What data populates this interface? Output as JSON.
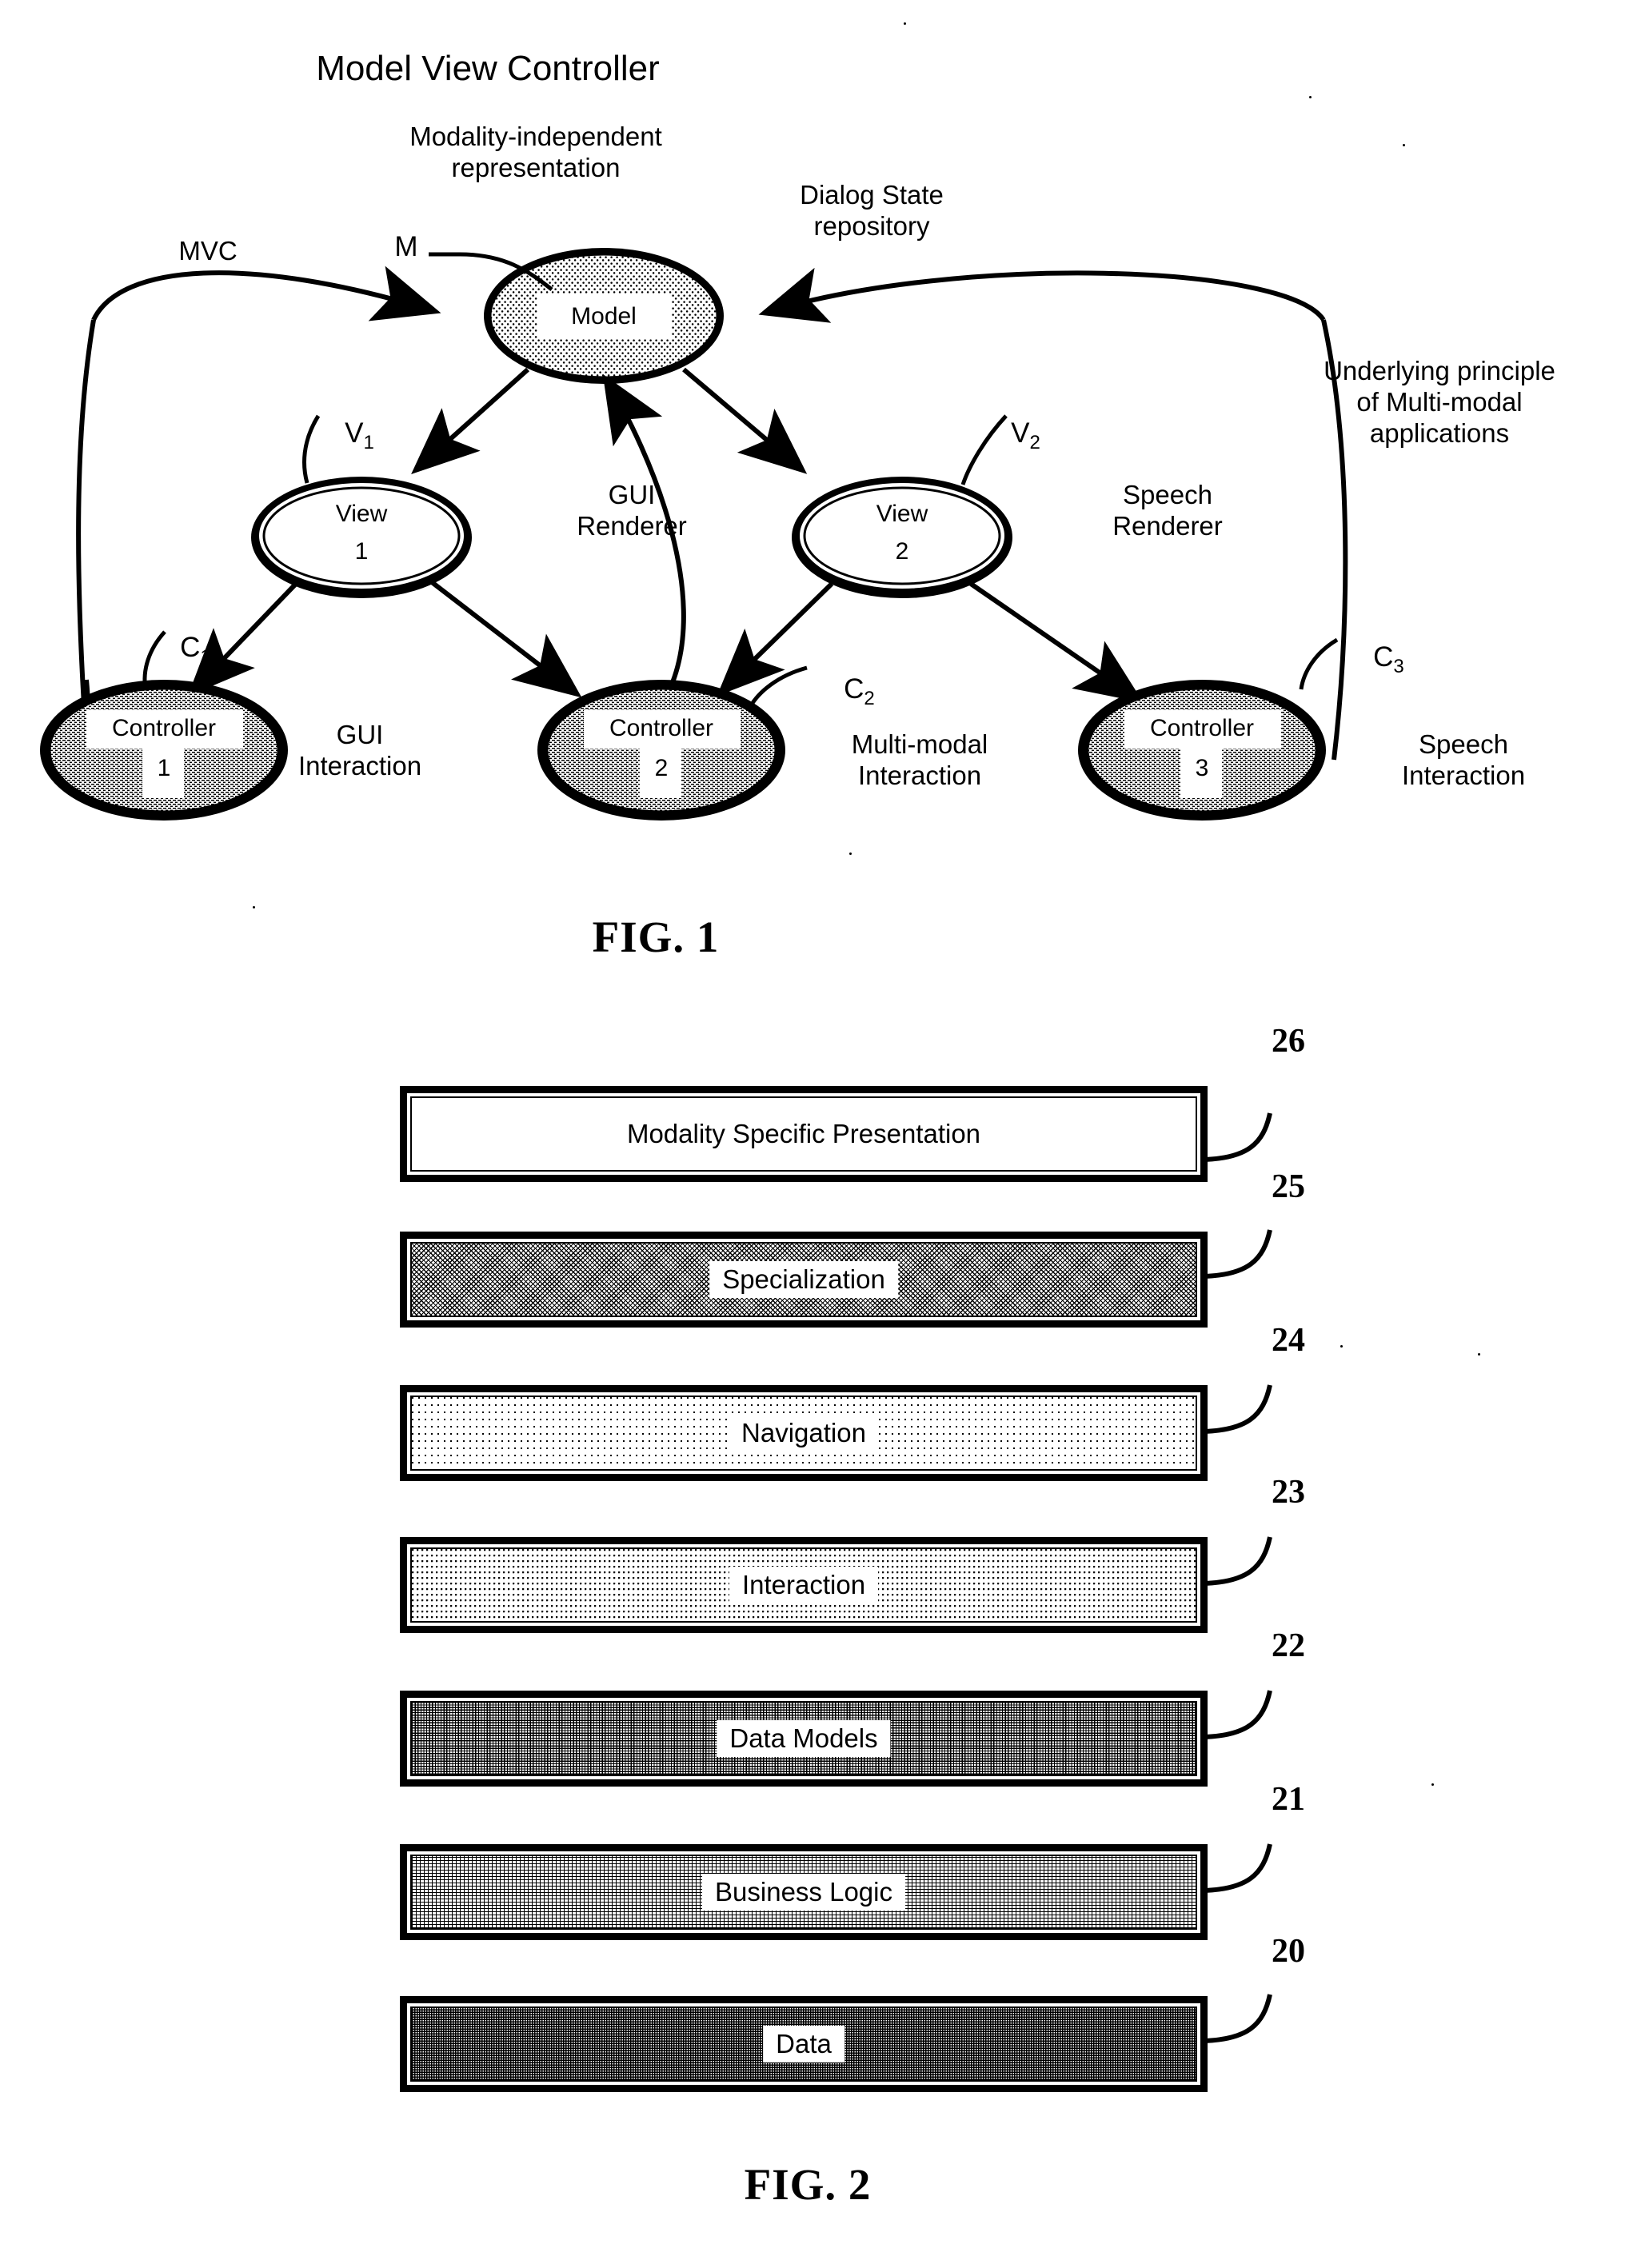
{
  "figure1": {
    "title": "Model View Controller",
    "caption": "FIG. 1",
    "annotations": {
      "modality_independent": "Modality-independent\nrepresentation",
      "dialog_state": "Dialog State\nrepository",
      "mvc": "MVC",
      "underlying_principle": "Underlying principle\nof Multi-modal\napplications",
      "gui_renderer": "GUI\nRenderer",
      "speech_renderer": "Speech\nRenderer",
      "gui_interaction": "GUI\nInteraction",
      "multimodal_interaction": "Multi-modal\nInteraction",
      "speech_interaction": "Speech\nInteraction"
    },
    "nodes": {
      "model": {
        "label": "Model",
        "ref": "M"
      },
      "view1": {
        "label_line1": "View",
        "label_line2": "1",
        "ref_base": "V",
        "ref_sub": "1"
      },
      "view2": {
        "label_line1": "View",
        "label_line2": "2",
        "ref_base": "V",
        "ref_sub": "2"
      },
      "controller1": {
        "label_line1": "Controller",
        "label_line2": "1",
        "ref_base": "C",
        "ref_sub": "1"
      },
      "controller2": {
        "label_line1": "Controller",
        "label_line2": "2",
        "ref_base": "C",
        "ref_sub": "2"
      },
      "controller3": {
        "label_line1": "Controller",
        "label_line2": "3",
        "ref_base": "C",
        "ref_sub": "3"
      }
    }
  },
  "figure2": {
    "caption": "FIG. 2",
    "layers": [
      {
        "label": "Modality Specific Presentation",
        "ref": "26",
        "fill": "f-white"
      },
      {
        "label": "Specialization",
        "ref": "25",
        "fill": "f-l5"
      },
      {
        "label": "Navigation",
        "ref": "24",
        "fill": "f-l1"
      },
      {
        "label": "Interaction",
        "ref": "23",
        "fill": "f-l2"
      },
      {
        "label": "Data Models",
        "ref": "22",
        "fill": "f-l4"
      },
      {
        "label": "Business Logic",
        "ref": "21",
        "fill": "f-l3"
      },
      {
        "label": "Data",
        "ref": "20",
        "fill": "f-l6"
      }
    ]
  },
  "colors": {
    "ink": "#000000",
    "paper": "#ffffff"
  }
}
